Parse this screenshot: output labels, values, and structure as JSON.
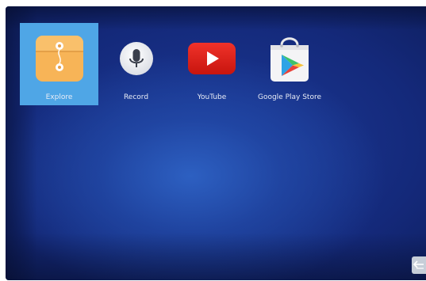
{
  "launcher": {
    "apps": [
      {
        "label": "Explore",
        "icon": "folder-icon",
        "selected": true
      },
      {
        "label": "Record",
        "icon": "microphone-icon",
        "selected": false
      },
      {
        "label": "YouTube",
        "icon": "youtube-icon",
        "selected": false
      },
      {
        "label": "Google Play Store",
        "icon": "play-store-icon",
        "selected": false
      }
    ],
    "back_icon": "back-arrow-icon"
  },
  "colors": {
    "selected_tile": "#4fa6e6",
    "background_deep": "#0c1a52",
    "background_glow": "#2e62c4",
    "folder_orange": "#f7b457",
    "youtube_red": "#e62117"
  }
}
